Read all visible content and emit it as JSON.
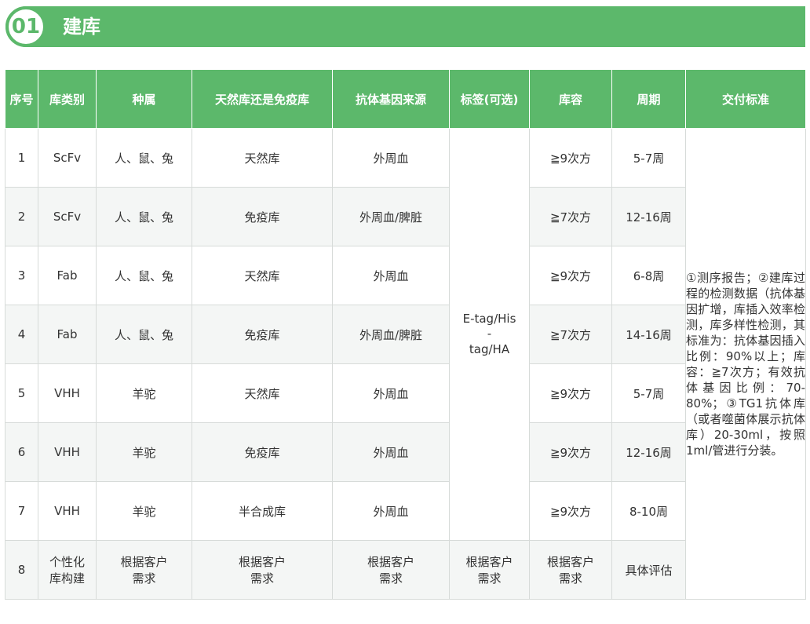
{
  "header": {
    "number": "01",
    "title": "建库"
  },
  "table": {
    "columns": [
      "序号",
      "库类别",
      "种属",
      "天然库还是免疫库",
      "抗体基因来源",
      "标签(可选)",
      "库容",
      "周期",
      "交付标准"
    ],
    "rows": [
      {
        "no": "1",
        "type": "ScFv",
        "species": "人、鼠、兔",
        "library": "天然库",
        "source": "外周血",
        "capacity": "≧9次方",
        "period": "5-7周"
      },
      {
        "no": "2",
        "type": "ScFv",
        "species": "人、鼠、兔",
        "library": "免疫库",
        "source": "外周血/脾脏",
        "capacity": "≧7次方",
        "period": "12-16周"
      },
      {
        "no": "3",
        "type": "Fab",
        "species": "人、鼠、兔",
        "library": "天然库",
        "source": "外周血",
        "capacity": "≧9次方",
        "period": "6-8周"
      },
      {
        "no": "4",
        "type": "Fab",
        "species": "人、鼠、兔",
        "library": "免疫库",
        "source": "外周血/脾脏",
        "capacity": "≧7次方",
        "period": "14-16周"
      },
      {
        "no": "5",
        "type": "VHH",
        "species": "羊驼",
        "library": "天然库",
        "source": "外周血",
        "capacity": "≧9次方",
        "period": "5-7周"
      },
      {
        "no": "6",
        "type": "VHH",
        "species": "羊驼",
        "library": "免疫库",
        "source": "外周血",
        "capacity": "≧9次方",
        "period": "12-16周"
      },
      {
        "no": "7",
        "type": "VHH",
        "species": "羊驼",
        "library": "半合成库",
        "source": "外周血",
        "capacity": "≧9次方",
        "period": "8-10周"
      }
    ],
    "tag_merged": [
      "E-tag/His",
      "-",
      "tag/HA"
    ],
    "standard": "①测序报告；②建库过程的检测数据（抗体基因扩增，库插入效率检测，库多样性检测，其标准为：抗体基因插入比例：90%以上；库容：≧7次方；有效抗体基因比例：70-80%；③TG1抗体库（或者噬菌体展示抗体库）20-30ml，按照1ml/管进行分装。",
    "last_row": {
      "no": "8",
      "type": [
        "个性化",
        "库构建"
      ],
      "species": [
        "根据客户",
        "需求"
      ],
      "library": [
        "根据客户",
        "需求"
      ],
      "source": [
        "根据客户",
        "需求"
      ],
      "tag": [
        "根据客户",
        "需求"
      ],
      "capacity": [
        "根据客户",
        "需求"
      ],
      "period": "具体评估"
    }
  }
}
